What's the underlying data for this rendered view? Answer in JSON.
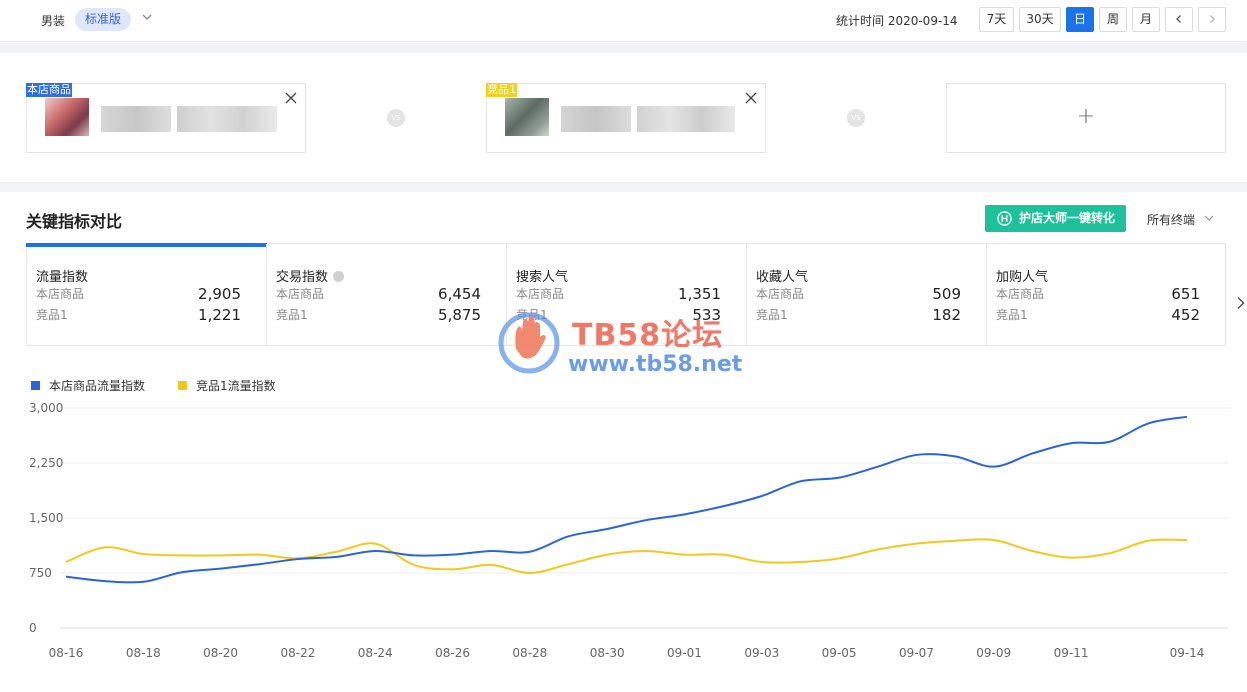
{
  "header": {
    "category": "男装",
    "version_badge": "标准版",
    "stat_time": "统计时间 2020-09-14",
    "range_buttons": [
      "7天",
      "30天",
      "日",
      "周",
      "月"
    ],
    "active_range": "日"
  },
  "compare": {
    "self_tag": "本店商品",
    "competitor_tag": "竞品1",
    "vs_label": "VS",
    "add_label": "+"
  },
  "section": {
    "title": "关键指标对比",
    "cta_label": "护店大师一键转化",
    "terminal_label": "所有终端"
  },
  "metrics": [
    {
      "title": "流量指数",
      "self_label": "本店商品",
      "self_value": "2,905",
      "comp_label": "竞品1",
      "comp_value": "1,221"
    },
    {
      "title": "交易指数",
      "self_label": "本店商品",
      "self_value": "6,454",
      "comp_label": "竞品1",
      "comp_value": "5,875"
    },
    {
      "title": "搜索人气",
      "self_label": "本店商品",
      "self_value": "1,351",
      "comp_label": "竞品1",
      "comp_value": "533"
    },
    {
      "title": "收藏人气",
      "self_label": "本店商品",
      "self_value": "509",
      "comp_label": "竞品1",
      "comp_value": "182"
    },
    {
      "title": "加购人气",
      "self_label": "本店商品",
      "self_value": "651",
      "comp_label": "竞品1",
      "comp_value": "452"
    }
  ],
  "watermark": {
    "title": "TB58论坛",
    "url": "www.tb58.net"
  },
  "colors": {
    "accent": "#1a73e8",
    "self_series": "#2b63d9",
    "comp_series": "#f2c81f",
    "cta": "#1ec29a"
  },
  "chart_data": {
    "type": "line",
    "x": [
      "08-16",
      "08-17",
      "08-18",
      "08-19",
      "08-20",
      "08-21",
      "08-22",
      "08-23",
      "08-24",
      "08-25",
      "08-26",
      "08-27",
      "08-28",
      "08-29",
      "08-30",
      "08-31",
      "09-01",
      "09-02",
      "09-03",
      "09-04",
      "09-05",
      "09-06",
      "09-07",
      "09-08",
      "09-09",
      "09-10",
      "09-11",
      "09-12",
      "09-13",
      "09-14"
    ],
    "x_tick_labels": [
      "08-16",
      "08-18",
      "08-20",
      "08-22",
      "08-24",
      "08-26",
      "08-28",
      "08-30",
      "09-01",
      "09-03",
      "09-05",
      "09-07",
      "09-09",
      "09-11",
      "09-14"
    ],
    "y_ticks": [
      0,
      750,
      1500,
      2250,
      3000
    ],
    "y_tick_labels": [
      "0",
      "750",
      "1,500",
      "2,250",
      "3,000"
    ],
    "ylim": [
      0,
      3000
    ],
    "grid": true,
    "legend_position": "top-left",
    "series": [
      {
        "name": "本店商品流量指数",
        "color": "#2b63d9",
        "values": [
          700,
          640,
          630,
          760,
          810,
          870,
          940,
          970,
          1050,
          990,
          1000,
          1050,
          1040,
          1250,
          1350,
          1470,
          1550,
          1660,
          1800,
          2000,
          2050,
          2200,
          2360,
          2340,
          2200,
          2380,
          2520,
          2540,
          2790,
          2880
        ]
      },
      {
        "name": "竞品1流量指数",
        "color": "#f2c81f",
        "values": [
          900,
          1100,
          1010,
          990,
          990,
          1000,
          950,
          1040,
          1150,
          860,
          800,
          860,
          750,
          870,
          1000,
          1050,
          1000,
          1000,
          900,
          900,
          950,
          1070,
          1150,
          1190,
          1200,
          1050,
          960,
          1020,
          1190,
          1200
        ]
      }
    ]
  }
}
